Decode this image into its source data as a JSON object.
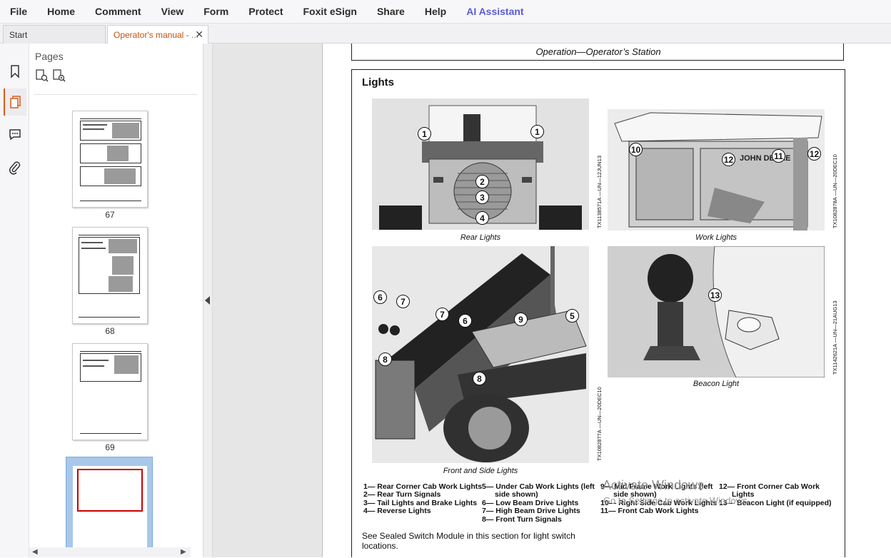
{
  "menu": {
    "items": [
      "File",
      "Home",
      "Comment",
      "View",
      "Form",
      "Protect",
      "Foxit eSign",
      "Share",
      "Help"
    ],
    "ai_label": "AI Assistant"
  },
  "tabs": {
    "start_label": "Start",
    "doc_label": "Operator's manual - ...",
    "close_glyph": "✕"
  },
  "pages_panel": {
    "title": "Pages",
    "thumbs": [
      "67",
      "68",
      "69"
    ]
  },
  "document": {
    "running_header": "Operation—Operator’s Station",
    "section_title": "Lights",
    "figures": {
      "rear": {
        "caption": "Rear Lights",
        "id": "TX1138571A —UN—12JUN13"
      },
      "work": {
        "caption": "Work Lights",
        "id": "TX1082878A —UN—20DEC10"
      },
      "front": {
        "caption": "Front and Side Lights",
        "id": "TX1082877A —UN—20DEC10"
      },
      "beacon": {
        "caption": "Beacon Light",
        "id": "TX1142621A —UN—21AUG13"
      }
    },
    "callouts": {
      "c1": "1",
      "c2": "2",
      "c3": "3",
      "c4": "4",
      "c5": "5",
      "c6": "6",
      "c7": "7",
      "c8": "8",
      "c9": "9",
      "c10": "10",
      "c11": "11",
      "c12": "12",
      "c13": "13"
    },
    "legend": {
      "col1": [
        "1— Rear Corner Cab Work Lights",
        "2— Rear Turn Signals",
        "3— Tail Lights and Brake Lights",
        "4— Reverse Lights"
      ],
      "col2_a": "5— Under Cab Work Lights (left",
      "col2_a2": "side shown)",
      "col2": [
        "6— Low Beam Drive Lights",
        "7— High Beam Drive Lights",
        "8— Front Turn Signals"
      ],
      "col3_a": "9— Mid Frame Work Lights (left",
      "col3_a2": "side shown)",
      "col3": [
        "10— Right Side Cab Work Lights",
        "11— Front Cab Work Lights"
      ],
      "col4_a": "12— Front Corner Cab Work",
      "col4_a2": "Lights",
      "col4": [
        "13— Beacon Light (if equipped)"
      ]
    },
    "note": "See Sealed Switch Module in this section for light switch locations."
  },
  "watermark": {
    "line1": "Activate Windows",
    "line2": "Go to Settings to activate Windows."
  }
}
